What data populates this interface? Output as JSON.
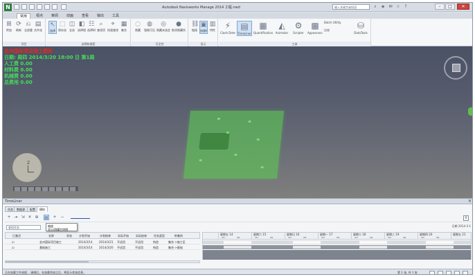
{
  "titlebar": {
    "title": "Autodesk Navisworks Manage 2014  工程.nwd",
    "search_placeholder": "键入关键字或短语"
  },
  "ribbon": {
    "tabs": [
      "常用",
      "视点",
      "审阅",
      "动画",
      "查看",
      "输出",
      "工具"
    ],
    "groups": [
      {
        "label": "项目",
        "buttons": [
          "附加",
          "刷新",
          "全部重置",
          "文件选项"
        ]
      },
      {
        "label": "选择和搜索",
        "buttons": [
          "选择",
          "保存选择",
          "全选",
          "选择相同对象",
          "选择树",
          "查找项目",
          "快速查找",
          "集合"
        ]
      },
      {
        "label": "可见性",
        "buttons": [
          "隐藏",
          "强制可见",
          "隐藏未选定对象",
          "取消隐藏所有对象"
        ]
      },
      {
        "label": "显示",
        "buttons": [
          "链接",
          "快捷特性",
          "特性"
        ]
      },
      {
        "label": "工具",
        "buttons": [
          "Clash Detective",
          "TimeLiner",
          "Quantification",
          "Animator",
          "Scripter",
          "Appearance Profiler",
          "Batch Utility",
          "比较",
          "DataTools"
        ]
      }
    ]
  },
  "viewport": {
    "hud_title": "金州国际项目施工模拟",
    "hud_lines": [
      "日期: 周四 2014/3/20  18:00  日 第1周",
      "人工费 0.00",
      "材料费 0.00",
      "机械费 0.00",
      "总费用 0.00"
    ],
    "axis_label": "Z"
  },
  "timeliner": {
    "title": "TimeLiner",
    "tabs": [
      "任务",
      "数据源",
      "配置",
      "模拟"
    ],
    "tooltip_title": "缩放",
    "tooltip_body": "显示/隐藏甘特图",
    "filter_placeholder": "查找任务",
    "date_right": "日期\n2014-3-1",
    "columns": [
      "已激活",
      "名称",
      "状态",
      "计划开始",
      "计划结束",
      "实际开始",
      "实际结束",
      "任务类型",
      "附着的"
    ],
    "rows": [
      {
        "active": "☑",
        "name": "金州国际项目施工",
        "status": "",
        "plan_start": "2014/3/14",
        "plan_end": "2014/3/21",
        "actual_start": "不适用",
        "actual_end": "不适用",
        "type": "构造",
        "attached": "集合->施工区"
      },
      {
        "active": "☑",
        "name": "基础施工",
        "status": "",
        "plan_start": "2014/3/14",
        "plan_end": "2014/3/20",
        "actual_start": "不适用",
        "actual_end": "不适用",
        "type": "构造",
        "attached": "集合->基础"
      }
    ],
    "gantt_days": [
      "星期五 14",
      "星期六 15",
      "星期日 16",
      "星期一 17",
      "星期二 18",
      "星期三 19",
      "星期四 20",
      "星期五 21"
    ],
    "ampm": [
      "AM",
      "PM"
    ]
  },
  "statusbar": {
    "text": "正在加载工作流程... 请稍后，在加载完成之后，将显示状态信息。",
    "coords": "第 1 张, 共 1 张"
  },
  "colors": {
    "hud_title": "#e02b22",
    "hud_text": "#44e05a",
    "model": "#5cc854"
  }
}
